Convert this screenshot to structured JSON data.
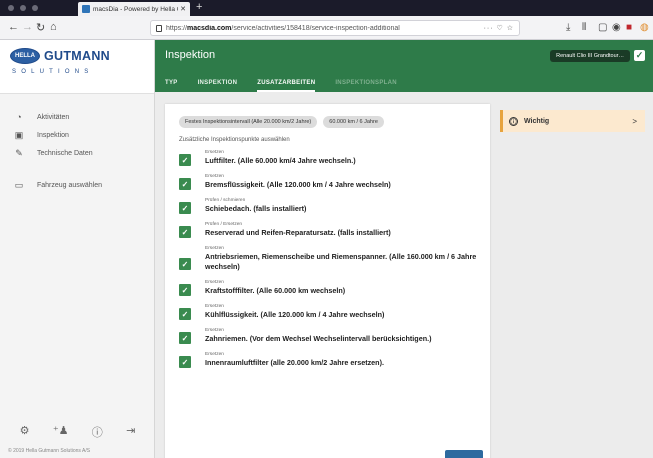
{
  "browser": {
    "tab_title": "macsDia - Powered by Hella Gut…",
    "tab_close": "✕",
    "new_tab": "+",
    "url_prefix": "https://",
    "url_domain": "macsdia.com",
    "url_path": "/service/activities/158418/service-inspection-additional",
    "url_actions": "··· ♡ ☆"
  },
  "logo": {
    "badge": "HELLA",
    "name": "GUTMANN",
    "sub": "SOLUTIONS"
  },
  "sidebar": {
    "items": [
      {
        "label": "Aktivitäten",
        "icon": "activity-icon",
        "glyph": "◔"
      },
      {
        "label": "Inspektion",
        "icon": "inspection-icon",
        "glyph": "▣"
      },
      {
        "label": "Technische Daten",
        "icon": "wrench-icon",
        "glyph": "✎"
      },
      {
        "label": "Fahrzeug auswählen",
        "icon": "car-icon",
        "glyph": "▭"
      }
    ],
    "footer_icons": [
      {
        "name": "settings-icon",
        "glyph": "⚙"
      },
      {
        "name": "user-add-icon",
        "glyph": "⁺♟"
      },
      {
        "name": "info-icon",
        "glyph": "ⓘ"
      },
      {
        "name": "logout-icon",
        "glyph": "⇥"
      }
    ],
    "copyright": "© 2019 Hella Gutmann Solutions A/S"
  },
  "header": {
    "title": "Inspektion",
    "vehicle": "Renault Clio III Grandtour…",
    "check": "✓",
    "tabs": [
      {
        "label": "TYP",
        "state": "normal"
      },
      {
        "label": "INSPEKTION",
        "state": "normal"
      },
      {
        "label": "ZUSATZARBEITEN",
        "state": "active"
      },
      {
        "label": "INSPEKTIONSPLAN",
        "state": "disabled"
      }
    ]
  },
  "card": {
    "chips": [
      "Festes Inspektionsintervall (Alle 20.000 km/2 Jahre)",
      "60.000 km / 6 Jahre"
    ],
    "section_label": "Zusätzliche Inspektionspunkte auswählen",
    "items": [
      {
        "category": "Ersetzen",
        "title": "Luftfilter. (Alle 60.000 km/4 Jahre wechseln.)",
        "checked": true
      },
      {
        "category": "Ersetzen",
        "title": "Bremsflüssigkeit. (Alle 120.000 km / 4 Jahre wechseln)",
        "checked": true
      },
      {
        "category": "Prüfen / schmieren",
        "title": "Schiebedach. (falls installiert)",
        "checked": true
      },
      {
        "category": "Prüfen / Ersetzen",
        "title": "Reserverad und Reifen-Reparatursatz. (falls installiert)",
        "checked": true
      },
      {
        "category": "Ersetzen",
        "title": "Antriebsriemen, Riemenscheibe und Riemenspanner. (Alle 160.000 km / 6 Jahre wechseln)",
        "checked": true
      },
      {
        "category": "Ersetzen",
        "title": "Kraftstofffilter. (Alle 60.000 km wechseln)",
        "checked": true
      },
      {
        "category": "Ersetzen",
        "title": "Kühlflüssigkeit. (Alle 120.000 km / 4 Jahre wechseln)",
        "checked": true
      },
      {
        "category": "Ersetzen",
        "title": "Zahnriemen. (Vor dem Wechsel Wechselintervall berücksichtigen.)",
        "checked": true
      },
      {
        "category": "Ersetzen",
        "title": "Innenraumluftfilter (alle 20.000 km/2 Jahre ersetzen).",
        "checked": true
      }
    ]
  },
  "wichtig": {
    "label": "Wichtig",
    "icon": "ⓘ",
    "chevron": ">"
  },
  "colors": {
    "header_green": "#2e7b49",
    "checkbox_green": "#3a8b4f",
    "notice_bg": "#fce9cf",
    "notice_accent": "#e7a33d",
    "brand_blue": "#1f4a8a"
  }
}
